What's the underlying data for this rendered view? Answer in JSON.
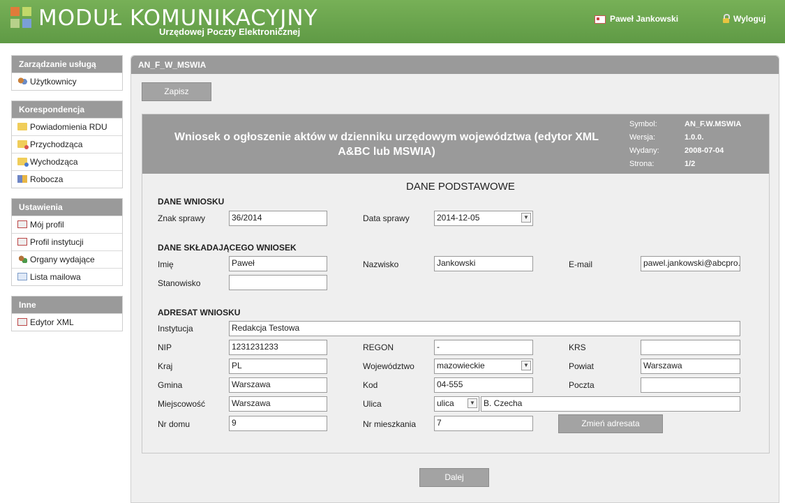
{
  "header": {
    "title": "MODUŁ KOMUNIKACYJNY",
    "subtitle": "Urzędowej Poczty Elektronicznej",
    "user": "Paweł Jankowski",
    "logout": "Wyloguj"
  },
  "sidebar": {
    "groups": [
      {
        "title": "Zarządzanie usługą",
        "items": [
          {
            "label": "Użytkownicy",
            "icon": "users-icon"
          }
        ]
      },
      {
        "title": "Korespondencja",
        "items": [
          {
            "label": "Powiadomienia RDU",
            "icon": "folder-icon"
          },
          {
            "label": "Przychodząca",
            "icon": "folder-incoming-icon"
          },
          {
            "label": "Wychodząca",
            "icon": "folder-outgoing-icon"
          },
          {
            "label": "Robocza",
            "icon": "draft-icon"
          }
        ]
      },
      {
        "title": "Ustawienia",
        "items": [
          {
            "label": "Mój profil",
            "icon": "id-card-icon"
          },
          {
            "label": "Profil instytucji",
            "icon": "id-card-icon"
          },
          {
            "label": "Organy wydające",
            "icon": "organization-icon"
          },
          {
            "label": "Lista mailowa",
            "icon": "mail-icon"
          }
        ]
      },
      {
        "title": "Inne",
        "items": [
          {
            "label": "Edytor XML",
            "icon": "xml-editor-icon"
          }
        ]
      }
    ]
  },
  "main": {
    "panel_title": "AN_F_W_MSWIA",
    "save_button": "Zapisz",
    "next_button": "Dalej",
    "form": {
      "title": "Wniosek o ogłoszenie aktów w dzienniku urzędowym województwa (edytor XML A&BC lub MSWIA)",
      "meta": {
        "symbol_label": "Symbol:",
        "symbol": "AN_F.W.MSWIA",
        "version_label": "Wersja:",
        "version": "1.0.0.",
        "issued_label": "Wydany:",
        "issued": "2008-07-04",
        "page_label": "Strona:",
        "page": "1/2"
      },
      "section": "DANE PODSTAWOWE",
      "dane_wniosku": {
        "title": "DANE WNIOSKU",
        "znak_label": "Znak sprawy",
        "znak": "36/2014",
        "data_label": "Data sprawy",
        "data": "2014-12-05"
      },
      "skladajacy": {
        "title": "DANE SKŁADAJĄCEGO WNIOSEK",
        "imie_label": "Imię",
        "imie": "Paweł",
        "nazwisko_label": "Nazwisko",
        "nazwisko": "Jankowski",
        "email_label": "E-mail",
        "email": "pawel.jankowski@abcpro.",
        "stanowisko_label": "Stanowisko",
        "stanowisko": ""
      },
      "adresat": {
        "title": "ADRESAT WNIOSKU",
        "instytucja_label": "Instytucja",
        "instytucja": "Redakcja Testowa",
        "nip_label": "NIP",
        "nip": "1231231233",
        "regon_label": "REGON",
        "regon": "-",
        "krs_label": "KRS",
        "krs": "",
        "kraj_label": "Kraj",
        "kraj": "PL",
        "woj_label": "Województwo",
        "woj": "mazowieckie",
        "powiat_label": "Powiat",
        "powiat": "Warszawa",
        "gmina_label": "Gmina",
        "gmina": "Warszawa",
        "kod_label": "Kod",
        "kod": "04-555",
        "poczta_label": "Poczta",
        "poczta": "",
        "miejscowosc_label": "Miejscowość",
        "miejscowosc": "Warszawa",
        "ulica_label": "Ulica",
        "ulica_prefix": "ulica",
        "ulica": "B. Czecha",
        "nr_domu_label": "Nr domu",
        "nr_domu": "9",
        "nr_mieszkania_label": "Nr mieszkania",
        "nr_mieszkania": "7",
        "change_button": "Zmień adresata"
      }
    }
  }
}
